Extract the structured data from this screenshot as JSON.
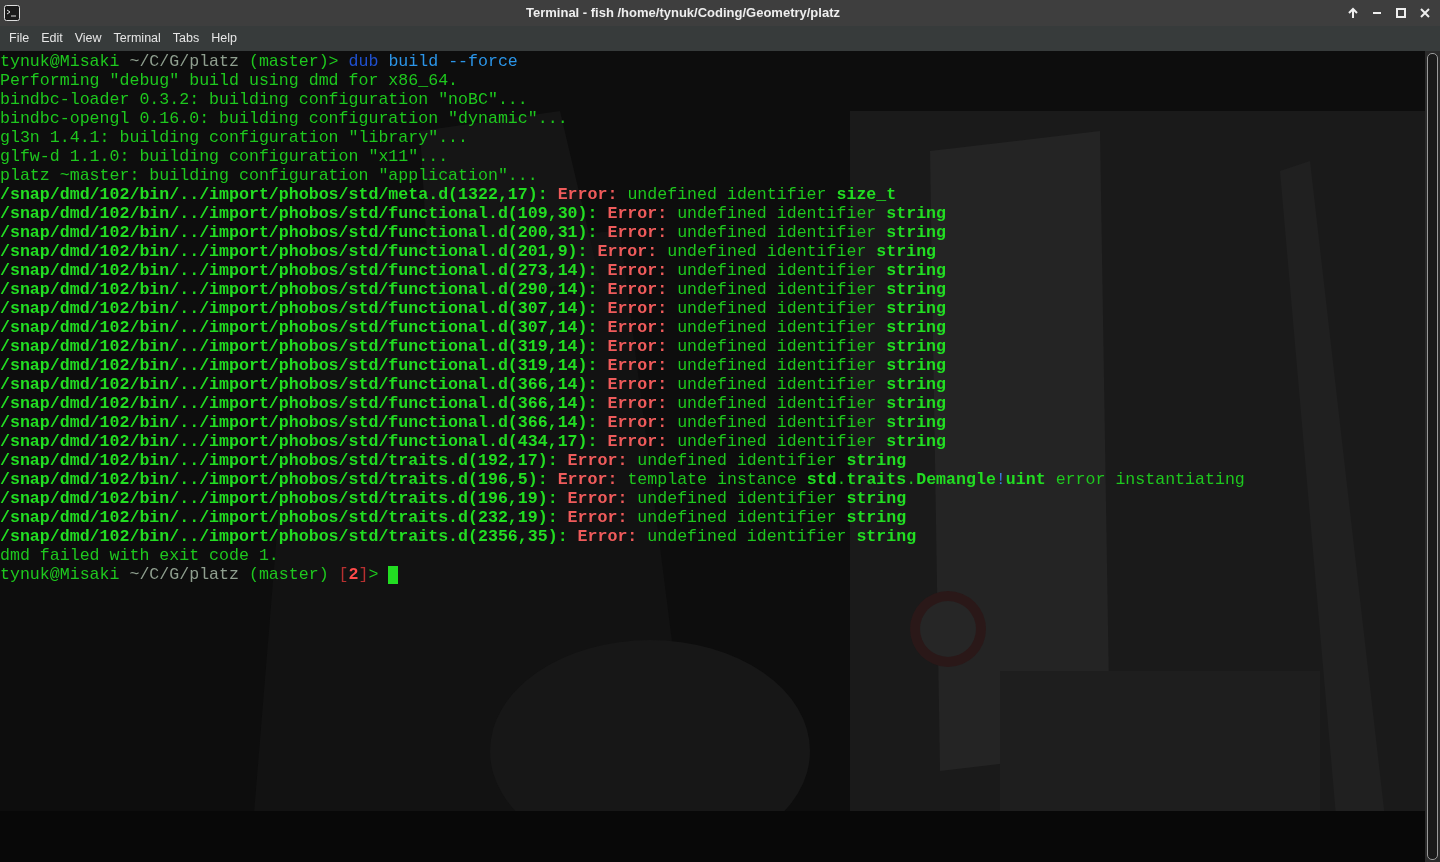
{
  "window": {
    "title": "Terminal - fish /home/tynuk/Coding/Geometry/platz"
  },
  "menu": [
    "File",
    "Edit",
    "View",
    "Terminal",
    "Tabs",
    "Help"
  ],
  "terminal": {
    "cursor": {
      "visible": true
    },
    "lines": [
      [
        {
          "text": "tynuk@Misaki ",
          "kind": "normal"
        },
        {
          "text": "~/C/G/platz",
          "kind": "dim"
        },
        {
          "text": " (master)> ",
          "kind": "normal"
        },
        {
          "text": "dub",
          "kind": "cmd"
        },
        {
          "text": " build --force",
          "kind": "arg"
        }
      ],
      [
        {
          "text": "Performing \"debug\" build using dmd for x86_64.",
          "kind": "normal"
        }
      ],
      [
        {
          "text": "bindbc-loader 0.3.2: building configuration \"noBC\"...",
          "kind": "normal"
        }
      ],
      [
        {
          "text": "bindbc-opengl 0.16.0: building configuration \"dynamic\"...",
          "kind": "normal"
        }
      ],
      [
        {
          "text": "gl3n 1.4.1: building configuration \"library\"...",
          "kind": "normal"
        }
      ],
      [
        {
          "text": "glfw-d 1.1.0: building configuration \"x11\"...",
          "kind": "normal"
        }
      ],
      [
        {
          "text": "platz ~master: building configuration \"application\"...",
          "kind": "normal"
        }
      ],
      [
        {
          "text": "/snap/dmd/102/bin/../import/phobos/std/meta.d(1322,17): ",
          "kind": "bold"
        },
        {
          "text": "Error: ",
          "kind": "error"
        },
        {
          "text": "undefined identifier ",
          "kind": "normal"
        },
        {
          "text": "size_t",
          "kind": "bold"
        }
      ],
      [
        {
          "text": "/snap/dmd/102/bin/../import/phobos/std/functional.d(109,30): ",
          "kind": "bold"
        },
        {
          "text": "Error: ",
          "kind": "error"
        },
        {
          "text": "undefined identifier ",
          "kind": "normal"
        },
        {
          "text": "string",
          "kind": "bold"
        }
      ],
      [
        {
          "text": "/snap/dmd/102/bin/../import/phobos/std/functional.d(200,31): ",
          "kind": "bold"
        },
        {
          "text": "Error: ",
          "kind": "error"
        },
        {
          "text": "undefined identifier ",
          "kind": "normal"
        },
        {
          "text": "string",
          "kind": "bold"
        }
      ],
      [
        {
          "text": "/snap/dmd/102/bin/../import/phobos/std/functional.d(201,9): ",
          "kind": "bold"
        },
        {
          "text": "Error: ",
          "kind": "error"
        },
        {
          "text": "undefined identifier ",
          "kind": "normal"
        },
        {
          "text": "string",
          "kind": "bold"
        }
      ],
      [
        {
          "text": "/snap/dmd/102/bin/../import/phobos/std/functional.d(273,14): ",
          "kind": "bold"
        },
        {
          "text": "Error: ",
          "kind": "error"
        },
        {
          "text": "undefined identifier ",
          "kind": "normal"
        },
        {
          "text": "string",
          "kind": "bold"
        }
      ],
      [
        {
          "text": "/snap/dmd/102/bin/../import/phobos/std/functional.d(290,14): ",
          "kind": "bold"
        },
        {
          "text": "Error: ",
          "kind": "error"
        },
        {
          "text": "undefined identifier ",
          "kind": "normal"
        },
        {
          "text": "string",
          "kind": "bold"
        }
      ],
      [
        {
          "text": "/snap/dmd/102/bin/../import/phobos/std/functional.d(307,14): ",
          "kind": "bold"
        },
        {
          "text": "Error: ",
          "kind": "error"
        },
        {
          "text": "undefined identifier ",
          "kind": "normal"
        },
        {
          "text": "string",
          "kind": "bold"
        }
      ],
      [
        {
          "text": "/snap/dmd/102/bin/../import/phobos/std/functional.d(307,14): ",
          "kind": "bold"
        },
        {
          "text": "Error: ",
          "kind": "error"
        },
        {
          "text": "undefined identifier ",
          "kind": "normal"
        },
        {
          "text": "string",
          "kind": "bold"
        }
      ],
      [
        {
          "text": "/snap/dmd/102/bin/../import/phobos/std/functional.d(319,14): ",
          "kind": "bold"
        },
        {
          "text": "Error: ",
          "kind": "error"
        },
        {
          "text": "undefined identifier ",
          "kind": "normal"
        },
        {
          "text": "string",
          "kind": "bold"
        }
      ],
      [
        {
          "text": "/snap/dmd/102/bin/../import/phobos/std/functional.d(319,14): ",
          "kind": "bold"
        },
        {
          "text": "Error: ",
          "kind": "error"
        },
        {
          "text": "undefined identifier ",
          "kind": "normal"
        },
        {
          "text": "string",
          "kind": "bold"
        }
      ],
      [
        {
          "text": "/snap/dmd/102/bin/../import/phobos/std/functional.d(366,14): ",
          "kind": "bold"
        },
        {
          "text": "Error: ",
          "kind": "error"
        },
        {
          "text": "undefined identifier ",
          "kind": "normal"
        },
        {
          "text": "string",
          "kind": "bold"
        }
      ],
      [
        {
          "text": "/snap/dmd/102/bin/../import/phobos/std/functional.d(366,14): ",
          "kind": "bold"
        },
        {
          "text": "Error: ",
          "kind": "error"
        },
        {
          "text": "undefined identifier ",
          "kind": "normal"
        },
        {
          "text": "string",
          "kind": "bold"
        }
      ],
      [
        {
          "text": "/snap/dmd/102/bin/../import/phobos/std/functional.d(366,14): ",
          "kind": "bold"
        },
        {
          "text": "Error: ",
          "kind": "error"
        },
        {
          "text": "undefined identifier ",
          "kind": "normal"
        },
        {
          "text": "string",
          "kind": "bold"
        }
      ],
      [
        {
          "text": "/snap/dmd/102/bin/../import/phobos/std/functional.d(434,17): ",
          "kind": "bold"
        },
        {
          "text": "Error: ",
          "kind": "error"
        },
        {
          "text": "undefined identifier ",
          "kind": "normal"
        },
        {
          "text": "string",
          "kind": "bold"
        }
      ],
      [
        {
          "text": "/snap/dmd/102/bin/../import/phobos/std/traits.d(192,17): ",
          "kind": "bold"
        },
        {
          "text": "Error: ",
          "kind": "error"
        },
        {
          "text": "undefined identifier ",
          "kind": "normal"
        },
        {
          "text": "string",
          "kind": "bold"
        }
      ],
      [
        {
          "text": "/snap/dmd/102/bin/../import/phobos/std/traits.d(196,5): ",
          "kind": "bold"
        },
        {
          "text": "Error: ",
          "kind": "error"
        },
        {
          "text": "template instance ",
          "kind": "normal"
        },
        {
          "text": "std",
          "kind": "bold"
        },
        {
          "text": ".",
          "kind": "normal"
        },
        {
          "text": "traits",
          "kind": "bold"
        },
        {
          "text": ".",
          "kind": "normal"
        },
        {
          "text": "Demangle",
          "kind": "bold"
        },
        {
          "text": "!",
          "kind": "bang"
        },
        {
          "text": "uint",
          "kind": "bold"
        },
        {
          "text": " error instantiating",
          "kind": "normal"
        }
      ],
      [
        {
          "text": "/snap/dmd/102/bin/../import/phobos/std/traits.d(196,19): ",
          "kind": "bold"
        },
        {
          "text": "Error: ",
          "kind": "error"
        },
        {
          "text": "undefined identifier ",
          "kind": "normal"
        },
        {
          "text": "string",
          "kind": "bold"
        }
      ],
      [
        {
          "text": "/snap/dmd/102/bin/../import/phobos/std/traits.d(232,19): ",
          "kind": "bold"
        },
        {
          "text": "Error: ",
          "kind": "error"
        },
        {
          "text": "undefined identifier ",
          "kind": "normal"
        },
        {
          "text": "string",
          "kind": "bold"
        }
      ],
      [
        {
          "text": "/snap/dmd/102/bin/../import/phobos/std/traits.d(2356,35): ",
          "kind": "bold"
        },
        {
          "text": "Error: ",
          "kind": "error"
        },
        {
          "text": "undefined identifier ",
          "kind": "normal"
        },
        {
          "text": "string",
          "kind": "bold"
        }
      ],
      [
        {
          "text": "dmd failed with exit code 1.",
          "kind": "normal"
        }
      ],
      [
        {
          "text": "tynuk@Misaki ",
          "kind": "normal"
        },
        {
          "text": "~/C/G/platz",
          "kind": "dim"
        },
        {
          "text": " (master) ",
          "kind": "normal"
        },
        {
          "text": "[",
          "kind": "bracket"
        },
        {
          "text": "2",
          "kind": "code"
        },
        {
          "text": "]",
          "kind": "bracket"
        },
        {
          "text": "> ",
          "kind": "normal"
        }
      ]
    ]
  }
}
